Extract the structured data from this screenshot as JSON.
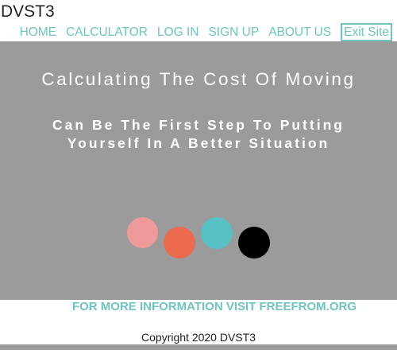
{
  "header": {
    "brand": "DVST3",
    "nav": {
      "home": "HOME",
      "calculator": "CALCULATOR",
      "login": "LOG IN",
      "signup": "SIGN UP",
      "about": "ABOUT US",
      "exit": "Exit Site"
    }
  },
  "hero": {
    "title": "Calculating The Cost Of Moving",
    "subtitle_line1": "Can Be The First Step To Putting",
    "subtitle_line2": "Yourself In A Better Situation"
  },
  "footer": {
    "more_info": "FOR MORE INFORMATION VISIT FREEFROM.ORG",
    "copyright": "Copyright 2020 DVST3"
  },
  "colors": {
    "accent": "#6fc4bf",
    "hero_bg": "#9b9b9b",
    "dot_pink": "#ee9a9b",
    "dot_orange": "#ec6b4e",
    "dot_teal": "#57c2c6",
    "dot_black": "#000000"
  }
}
